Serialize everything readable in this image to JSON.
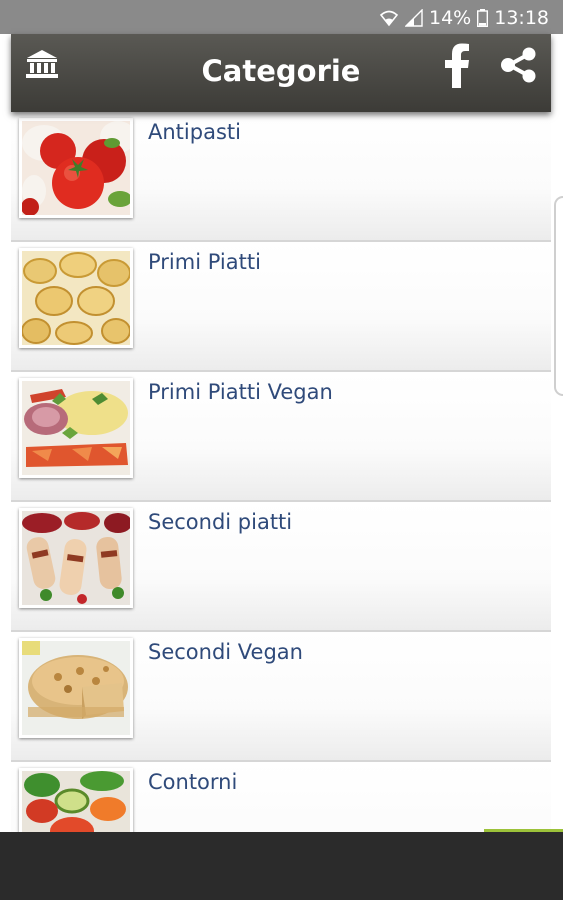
{
  "status_bar": {
    "battery": "14%",
    "time": "13:18"
  },
  "app_bar": {
    "title": "Categorie",
    "left_icon": "bank-icon",
    "right_icons": [
      "facebook-icon",
      "share-icon"
    ]
  },
  "categories": [
    {
      "label": "Antipasti",
      "image": "tomato-mozzarella-image"
    },
    {
      "label": "Primi Piatti",
      "image": "tortellini-image"
    },
    {
      "label": "Primi Piatti Vegan",
      "image": "vegan-first-course-image"
    },
    {
      "label": "Secondi piatti",
      "image": "rolled-meat-image"
    },
    {
      "label": "Secondi Vegan",
      "image": "savory-pie-image"
    },
    {
      "label": "Contorni",
      "image": "grilled-vegetables-image"
    }
  ],
  "colors": {
    "app_bar": "#4a4945",
    "label_text": "#2f4a7a",
    "status_bar": "#8a8a8a"
  }
}
